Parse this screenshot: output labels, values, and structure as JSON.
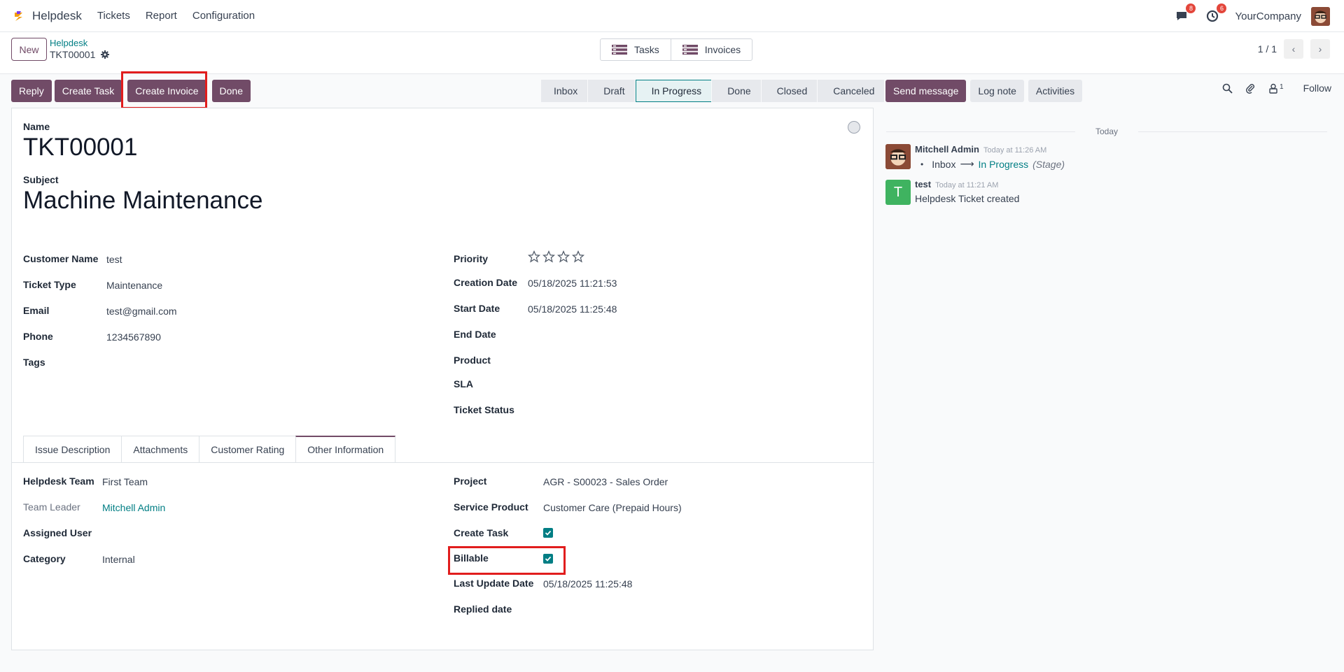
{
  "navbar": {
    "app_name": "Helpdesk",
    "menus": [
      "Tickets",
      "Report",
      "Configuration"
    ],
    "messages_count": "8",
    "activities_count": "6",
    "company": "YourCompany"
  },
  "control": {
    "new_label": "New",
    "breadcrumb_parent": "Helpdesk",
    "breadcrumb_current": "TKT00001",
    "smart_buttons": [
      "Tasks",
      "Invoices"
    ],
    "pager": "1 / 1"
  },
  "actions": [
    "Reply",
    "Create Task",
    "Create Invoice",
    "Done"
  ],
  "stages": [
    "Inbox",
    "Draft",
    "In Progress",
    "Done",
    "Closed",
    "Canceled"
  ],
  "active_stage": "In Progress",
  "chatter": {
    "buttons": [
      "Send message",
      "Log note",
      "Activities"
    ],
    "attachments_count": "1",
    "follow_label": "Follow",
    "day_label": "Today",
    "messages": [
      {
        "author": "Mitchell Admin",
        "time": "Today at 11:26 AM",
        "from": "Inbox",
        "arrow": "⟶",
        "to": "In Progress",
        "field": "(Stage)"
      },
      {
        "author": "test",
        "initial": "T",
        "time": "Today at 11:21 AM",
        "body": "Helpdesk Ticket created"
      }
    ]
  },
  "form": {
    "name_label": "Name",
    "name_value": "TKT00001",
    "subject_label": "Subject",
    "subject_value": "Machine Maintenance",
    "left_fields": [
      {
        "label": "Customer Name",
        "value": "test"
      },
      {
        "label": "Ticket Type",
        "value": "Maintenance"
      },
      {
        "label": "Email",
        "value": "test@gmail.com"
      },
      {
        "label": "Phone",
        "value": "1234567890"
      },
      {
        "label": "Tags",
        "value": ""
      }
    ],
    "right_fields": [
      {
        "label": "Priority",
        "value": ""
      },
      {
        "label": "Creation Date",
        "value": "05/18/2025 11:21:53"
      },
      {
        "label": "Start Date",
        "value": "05/18/2025 11:25:48"
      },
      {
        "label": "End Date",
        "value": ""
      },
      {
        "label": "Product",
        "value": ""
      },
      {
        "label": "SLA",
        "value": ""
      },
      {
        "label": "Ticket Status",
        "value": ""
      }
    ],
    "priority_stars": 0,
    "priority_max": 4,
    "tabs": [
      "Issue Description",
      "Attachments",
      "Customer Rating",
      "Other Information"
    ],
    "active_tab": "Other Information",
    "other_left": [
      {
        "label": "Helpdesk Team",
        "value": "First Team"
      },
      {
        "label": "Team Leader",
        "value": "Mitchell Admin"
      },
      {
        "label": "Assigned User",
        "value": ""
      },
      {
        "label": "Category",
        "value": "Internal"
      }
    ],
    "other_right": [
      {
        "label": "Project",
        "value": "AGR - S00023 - Sales Order"
      },
      {
        "label": "Service Product",
        "value": "Customer Care (Prepaid Hours)"
      },
      {
        "label": "Create Task",
        "value": true
      },
      {
        "label": "Billable",
        "value": true
      },
      {
        "label": "Last Update Date",
        "value": "05/18/2025 11:25:48"
      },
      {
        "label": "Replied date",
        "value": ""
      }
    ]
  },
  "colors": {
    "brand": "#714b67",
    "teal": "#017e84",
    "highlight": "#e11d1d"
  }
}
